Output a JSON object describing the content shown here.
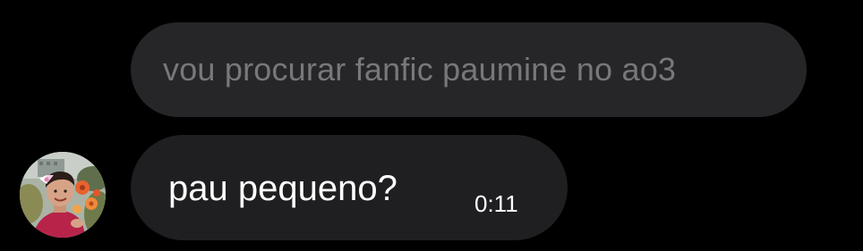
{
  "reply": {
    "text": "vou procurar fanfic paumine no ao3"
  },
  "message": {
    "text": "pau pequeno?",
    "time": "0:11"
  },
  "sender": {
    "avatar_icon": "profile-photo"
  },
  "colors": {
    "background": "#000000",
    "reply_bubble": "#262628",
    "reply_text": "#77777c",
    "message_bubble": "#1f1f21",
    "message_text": "#ffffff"
  }
}
